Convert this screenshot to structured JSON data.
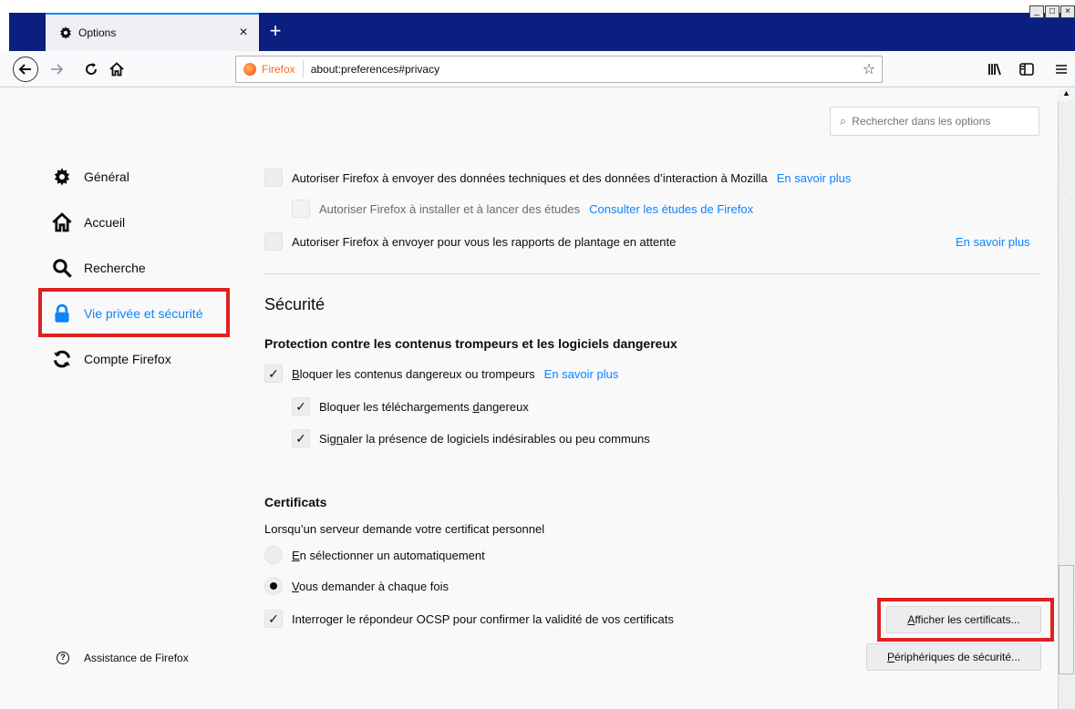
{
  "tab": {
    "title": "Options",
    "close": "×"
  },
  "newtab": "+",
  "window_controls": [
    "_",
    "□",
    "×"
  ],
  "urlbar": {
    "identity": "Firefox",
    "url": "about:preferences#privacy"
  },
  "search": {
    "placeholder": "Rechercher dans les options"
  },
  "sidebar": {
    "items": [
      {
        "label": "Général",
        "icon": "gear-icon"
      },
      {
        "label": "Accueil",
        "icon": "home-icon"
      },
      {
        "label": "Recherche",
        "icon": "search-icon"
      },
      {
        "label": "Vie privée et sécurité",
        "icon": "lock-icon"
      },
      {
        "label": "Compte Firefox",
        "icon": "sync-icon"
      }
    ],
    "support": "Assistance de Firefox"
  },
  "data_collection": {
    "telemetry": "Autoriser Firefox à envoyer des données techniques et des données d’interaction à Mozilla",
    "telemetry_link": "En savoir plus",
    "studies": "Autoriser Firefox à installer et à lancer des études",
    "studies_link": "Consulter les études de Firefox",
    "crash": "Autoriser Firefox à envoyer pour vous les rapports de plantage en attente",
    "crash_link": "En savoir plus"
  },
  "security": {
    "heading": "Sécurité",
    "protection_heading": "Protection contre les contenus trompeurs et les logiciels dangereux",
    "block_dangerous_u": "B",
    "block_dangerous_rest": "loquer les contenus dangereux ou trompeurs",
    "block_link": "En savoir plus",
    "block_downloads_pre": "Bloquer les téléchargements ",
    "block_downloads_u": "d",
    "block_downloads_post": "angereux",
    "warn_unwanted_pre": "Sig",
    "warn_unwanted_u": "n",
    "warn_unwanted_post": "aler la présence de logiciels indésirables ou peu communs"
  },
  "certificates": {
    "heading": "Certificats",
    "prompt": "Lorsqu’un serveur demande votre certificat personnel",
    "auto_u": "E",
    "auto_rest": "n sélectionner un automatiquement",
    "ask_u": "V",
    "ask_rest": "ous demander à chaque fois",
    "ocsp": "Interroger le répondeur OCSP pour confirmer la validité de vos certificats",
    "view_u": "A",
    "view_rest": "fficher les certificats...",
    "devices_u": "P",
    "devices_rest": "ériphériques de sécurité..."
  },
  "colors": {
    "accent": "#0a84ff",
    "highlight": "#e02020",
    "tabstrip": "#0a1f80"
  }
}
